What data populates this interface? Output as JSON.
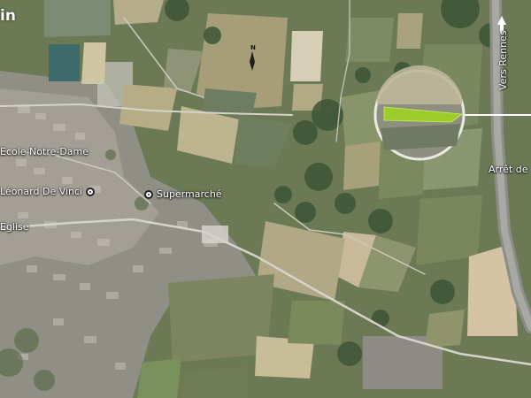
{
  "map": {
    "title_fragment": "in",
    "north_label": "N",
    "labels": {
      "ecole": "Ecole Notre-Dame",
      "leonard": "Léonard De Vinci",
      "supermarche": "Supermarché",
      "eglise": "Eglise",
      "vers_rennes": "Vers Rennes",
      "arret": "Arrêt de"
    },
    "colors": {
      "highlight_parcel": "#9ccc2a",
      "callout_line": "#ffffff"
    },
    "icons": {
      "poi": "map-pin-icon",
      "north_arrow": "north-arrow-icon",
      "arrow_up": "arrow-up-icon"
    }
  }
}
